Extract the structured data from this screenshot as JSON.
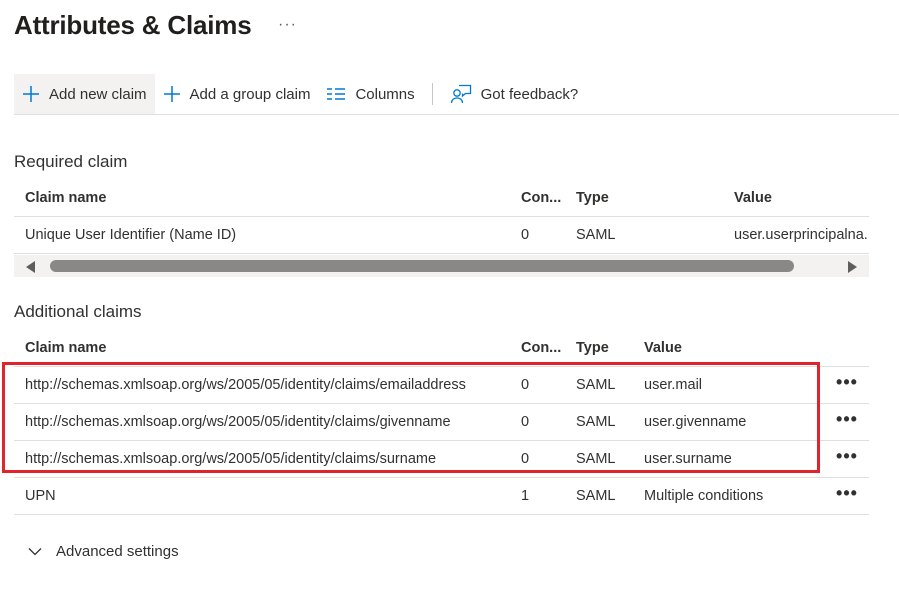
{
  "page": {
    "title": "Attributes & Claims",
    "more": "···"
  },
  "toolbar": {
    "add_new_claim": "Add new claim",
    "add_group_claim": "Add a group claim",
    "columns": "Columns",
    "feedback": "Got feedback?"
  },
  "required": {
    "title": "Required claim",
    "headers": {
      "name": "Claim name",
      "con": "Con...",
      "type": "Type",
      "value": "Value"
    },
    "rows": [
      {
        "name": "Unique User Identifier (Name ID)",
        "con": "0",
        "type": "SAML",
        "value": "user.userprincipalna.."
      }
    ]
  },
  "additional": {
    "title": "Additional claims",
    "headers": {
      "name": "Claim name",
      "con": "Con...",
      "type": "Type",
      "value": "Value"
    },
    "rows": [
      {
        "name": "http://schemas.xmlsoap.org/ws/2005/05/identity/claims/emailaddress",
        "con": "0",
        "type": "SAML",
        "value": "user.mail",
        "more": "•••"
      },
      {
        "name": "http://schemas.xmlsoap.org/ws/2005/05/identity/claims/givenname",
        "con": "0",
        "type": "SAML",
        "value": "user.givenname",
        "more": "•••"
      },
      {
        "name": "http://schemas.xmlsoap.org/ws/2005/05/identity/claims/surname",
        "con": "0",
        "type": "SAML",
        "value": "user.surname",
        "more": "•••"
      },
      {
        "name": "UPN",
        "con": "1",
        "type": "SAML",
        "value": "Multiple conditions",
        "more": "•••"
      }
    ]
  },
  "advanced": {
    "label": "Advanced settings"
  },
  "colors": {
    "accent": "#0078d4",
    "highlight": "#e0242b",
    "text": "#323130"
  }
}
